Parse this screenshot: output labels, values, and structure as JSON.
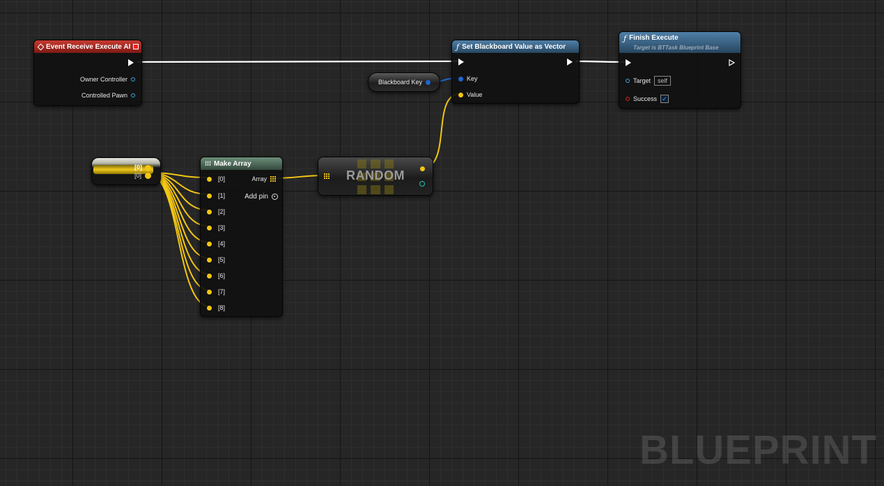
{
  "graph": {
    "watermark": "BLUEPRINT",
    "wire_colors": {
      "exec": "#ffffff",
      "vector": "#f3c614",
      "name": "#1e66d0"
    }
  },
  "nodes": {
    "event_receive": {
      "title": "Event Receive Execute AI",
      "header_color": "#b32a22",
      "pins": [
        "Owner Controller",
        "Controlled Pawn"
      ]
    },
    "set_bb_value": {
      "title": "Set Blackboard Value as Vector",
      "header_color": "#3f6b8f",
      "pins": {
        "key": "Key",
        "value": "Value"
      }
    },
    "finish_execute": {
      "title": "Finish Execute",
      "subtitle": "Target is BTTask Blueprint Base",
      "header_color": "#3f6b8f",
      "pins": {
        "target": "Target",
        "target_value": "self",
        "success": "Success",
        "success_checked": "✓"
      }
    },
    "blackboard_key": {
      "label": "Blackboard Key"
    },
    "reroute": {
      "labels": [
        "[0]",
        "[0]"
      ]
    },
    "make_array": {
      "title": "Make Array",
      "header_color": "#5a7a68",
      "inputs": [
        "[0]",
        "[1]",
        "[2]",
        "[3]",
        "[4]",
        "[5]",
        "[6]",
        "[7]",
        "[8]"
      ],
      "output": "Array",
      "add_pin": "Add pin"
    },
    "random": {
      "label": "RANDOM"
    }
  }
}
